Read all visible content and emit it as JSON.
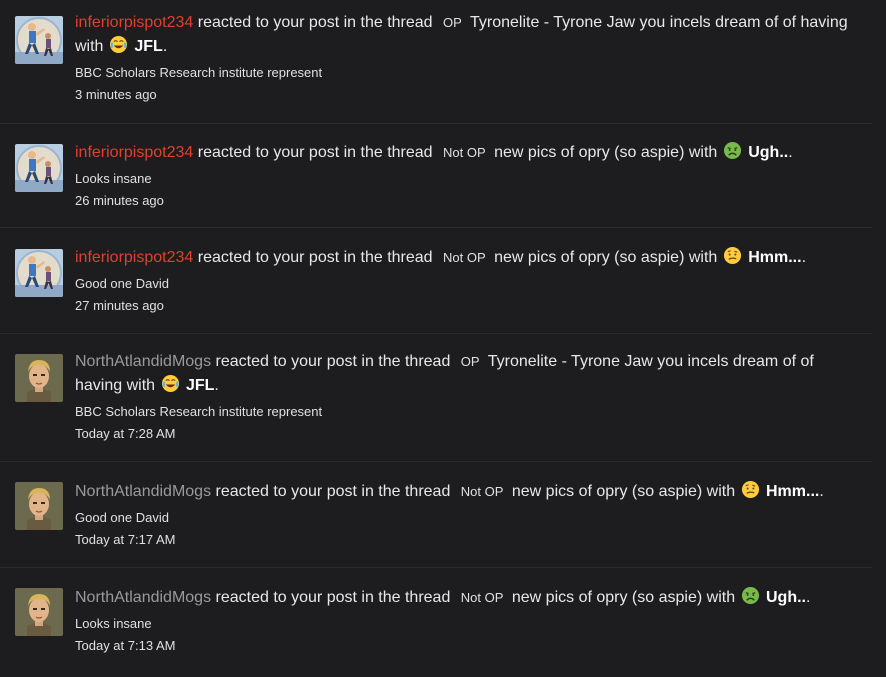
{
  "alerts": [
    {
      "username": "inferiorpispot234",
      "user_color": "#e0402e",
      "avatar": "illustrated-cartoon-avatar",
      "action": "reacted to your post in the thread",
      "prefix": "OP",
      "thread_title": "Tyronelite - Tyrone Jaw you incels dream of of having",
      "with_text": "with",
      "reaction_icon": "tears-of-joy-emoji",
      "reaction": "JFL",
      "trail": ".",
      "snippet": "BBC Scholars Research institute represent",
      "time": "3 minutes ago"
    },
    {
      "username": "inferiorpispot234",
      "user_color": "#e0402e",
      "avatar": "illustrated-cartoon-avatar",
      "action": "reacted to your post in the thread",
      "prefix": "Not OP",
      "thread_title": "new pics of opry (so aspie)",
      "with_text": "with",
      "reaction_icon": "nauseated-face-emoji",
      "reaction": "Ugh..",
      "trail": ".",
      "snippet": "Looks insane",
      "time": "26 minutes ago"
    },
    {
      "username": "inferiorpispot234",
      "user_color": "#e0402e",
      "avatar": "illustrated-cartoon-avatar",
      "action": "reacted to your post in the thread",
      "prefix": "Not OP",
      "thread_title": "new pics of opry (so aspie)",
      "with_text": "with",
      "reaction_icon": "confused-face-emoji",
      "reaction": "Hmm...",
      "trail": ".",
      "snippet": "Good one David",
      "time": "27 minutes ago"
    },
    {
      "username": "NorthAtlandidMogs",
      "user_color": "#9a9a9a",
      "avatar": "cartoon-man-avatar",
      "action": "reacted to your post in the thread",
      "prefix": "OP",
      "thread_title": "Tyronelite - Tyrone Jaw you incels dream of of having",
      "with_text": "with",
      "reaction_icon": "tears-of-joy-emoji",
      "reaction": "JFL",
      "trail": ".",
      "snippet": "BBC Scholars Research institute represent",
      "time": "Today at 7:28 AM"
    },
    {
      "username": "NorthAtlandidMogs",
      "user_color": "#9a9a9a",
      "avatar": "cartoon-man-avatar",
      "action": "reacted to your post in the thread",
      "prefix": "Not OP",
      "thread_title": "new pics of opry (so aspie)",
      "with_text": "with",
      "reaction_icon": "confused-face-emoji",
      "reaction": "Hmm...",
      "trail": ".",
      "snippet": "Good one David",
      "time": "Today at 7:17 AM"
    },
    {
      "username": "NorthAtlandidMogs",
      "user_color": "#9a9a9a",
      "avatar": "cartoon-man-avatar",
      "action": "reacted to your post in the thread",
      "prefix": "Not OP",
      "thread_title": "new pics of opry (so aspie)",
      "with_text": "with",
      "reaction_icon": "nauseated-face-emoji",
      "reaction": "Ugh..",
      "trail": ".",
      "snippet": "Looks insane",
      "time": "Today at 7:13 AM"
    }
  ]
}
